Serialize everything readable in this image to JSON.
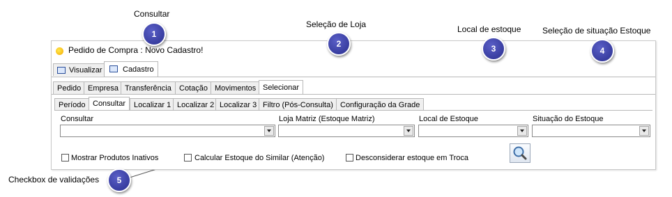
{
  "callouts": [
    {
      "number": "1",
      "label": "Consultar"
    },
    {
      "number": "2",
      "label": "Seleção de Loja"
    },
    {
      "number": "3",
      "label": "Local de estoque"
    },
    {
      "number": "4",
      "label": "Seleção de situação Estoque"
    },
    {
      "number": "5",
      "label": "Checkbox de validações"
    }
  ],
  "window": {
    "title": "Pedido de Compra : Novo Cadastro!",
    "view_tabs": [
      "Visualizar",
      "Cadastro"
    ],
    "main_tabs": [
      "Pedido",
      "Empresa",
      "Transferência",
      "Cotação",
      "Movimentos",
      "Selecionar"
    ],
    "sub_tabs": [
      "Período",
      "Consultar",
      "Localizar 1",
      "Localizar 2",
      "Localizar 3",
      "Filtro (Pós-Consulta)",
      "Configuração da Grade"
    ]
  },
  "filters": {
    "consultar_label": "Consultar",
    "consultar_value": "",
    "loja_label": "Loja Matriz (Estoque Matriz)",
    "loja_value": "",
    "local_label": "Local de Estoque",
    "local_value": "",
    "situacao_label": "Situação do Estoque",
    "situacao_value": ""
  },
  "checkboxes": [
    {
      "label": "Mostrar Produtos Inativos",
      "checked": false
    },
    {
      "label": "Calcular Estoque do Similar (Atenção)",
      "checked": false
    },
    {
      "label": "Desconsiderar estoque em Troca",
      "checked": false
    }
  ],
  "icons": {
    "search": "magnifier-icon",
    "badge_color": "#3b40a8"
  }
}
